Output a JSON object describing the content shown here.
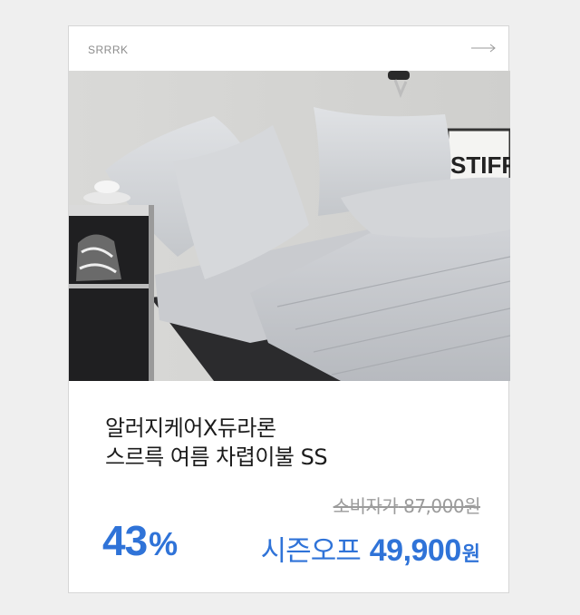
{
  "card": {
    "brand": "SRRRK",
    "arrow_icon": "arrow-right-icon",
    "photo": {
      "sign_text": "STIFF"
    },
    "title_lines": [
      "알러지케어X듀라론",
      "스르륵 여름 차렵이불 SS"
    ],
    "discount_value": "43",
    "discount_unit": "%",
    "original_price_label": "소비자가",
    "original_price": "87,000원",
    "sale_label": "시즌오프",
    "sale_price": "49,900",
    "sale_currency": "원",
    "colors": {
      "accent": "#2f73d8",
      "muted": "#9b9b9b",
      "text": "#1c1c1c"
    }
  }
}
